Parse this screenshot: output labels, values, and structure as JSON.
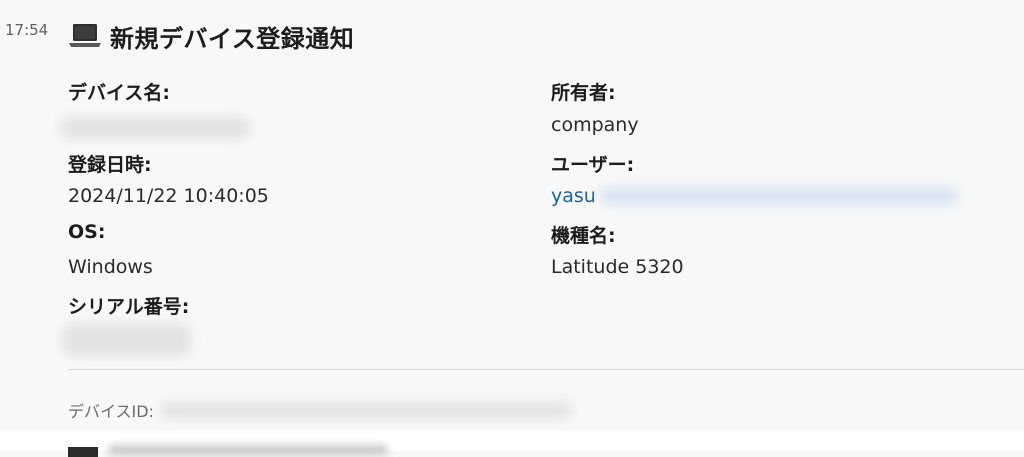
{
  "message": {
    "time": "17:54",
    "icon": "laptop-icon",
    "title": "新規デバイス登録通知"
  },
  "fields": {
    "device_name": {
      "label": "デバイス名:",
      "value": ""
    },
    "owner": {
      "label": "所有者:",
      "value": "company"
    },
    "registered_at": {
      "label": "登録日時:",
      "value": "2024/11/22 10:40:05"
    },
    "user": {
      "label": "ユーザー:",
      "value": "yasu"
    },
    "os": {
      "label": "OS:",
      "value": "Windows"
    },
    "model": {
      "label": "機種名:",
      "value": "Latitude 5320"
    },
    "serial": {
      "label": "シリアル番号:",
      "value": ""
    }
  },
  "footer": {
    "device_id_label": "デバイスID:",
    "device_id_value": ""
  },
  "colors": {
    "link": "#1264a3",
    "background": "#f8f8f8",
    "muted": "#616061"
  }
}
